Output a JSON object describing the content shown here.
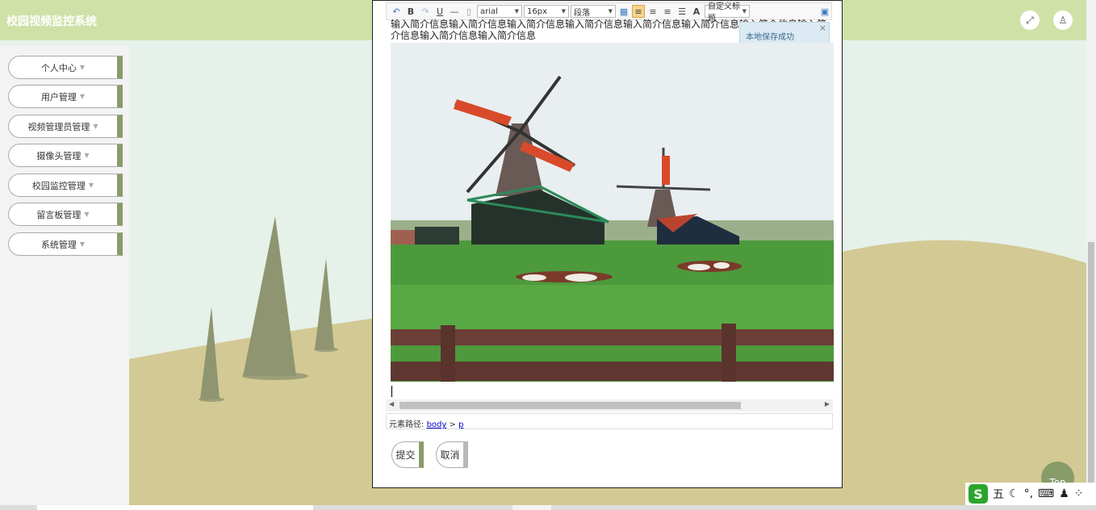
{
  "header": {
    "title": "校园视频监控系统",
    "fullscreen_icon": "expand-icon",
    "user_icon": "user-icon"
  },
  "sidebar": {
    "items": [
      {
        "label": "个人中心"
      },
      {
        "label": "用户管理"
      },
      {
        "label": "视频管理员管理"
      },
      {
        "label": "摄像头管理"
      },
      {
        "label": "校园监控管理"
      },
      {
        "label": "留言板管理"
      },
      {
        "label": "系统管理"
      }
    ]
  },
  "editor": {
    "toolbar": {
      "undo_icon": "undo-icon",
      "bold_label": "B",
      "redo_icon": "redo-icon",
      "underline_label": "U",
      "font_family": "arial",
      "font_size": "16px",
      "paragraph": "段落",
      "custom_title": "自定义标题"
    },
    "text": "输入简介信息输入简介信息输入简介信息输入简介信息输入简介信息输入简介信息输入简介信息输入简介信息输入简介信息输入简介信息",
    "toast": "本地保存成功",
    "path_label": "元素路径:",
    "path_body": "body",
    "path_sep": ">",
    "path_p": "p"
  },
  "form": {
    "submit_label": "提交",
    "cancel_label": "取消"
  },
  "top_button": "Top",
  "ime": {
    "mode_char": "五",
    "logo": "S"
  },
  "colors": {
    "header_bg": "#cfe1a7",
    "accent": "#889c6a",
    "hill": "#d3c994",
    "tree": "#8e9570"
  }
}
